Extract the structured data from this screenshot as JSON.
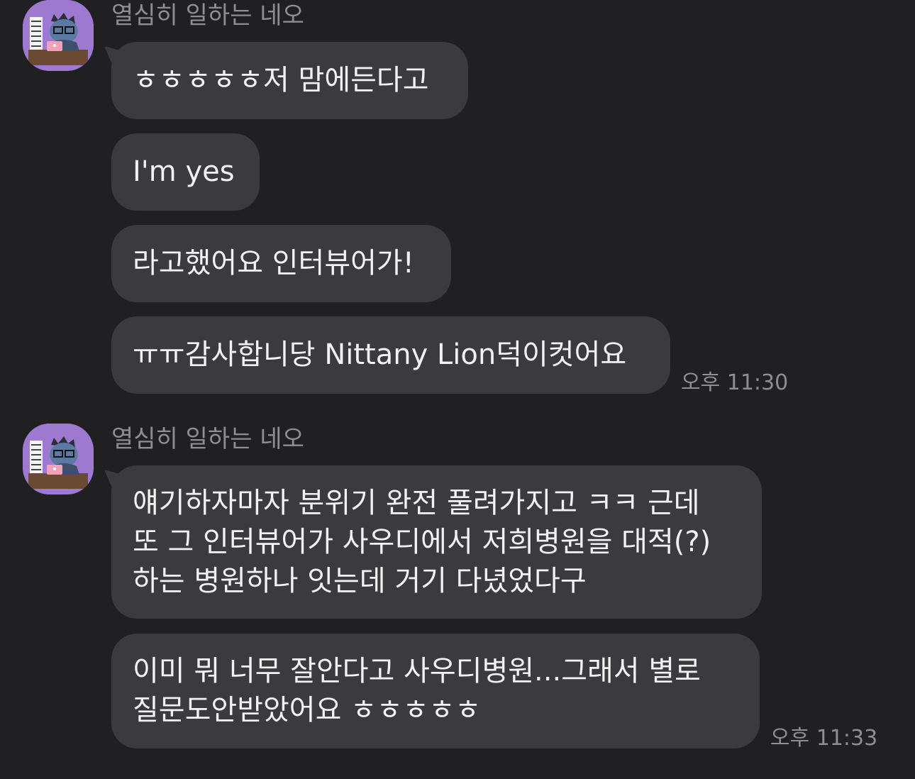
{
  "groups": [
    {
      "sender": "열심히 일하는 네오",
      "messages": [
        "ㅎㅎㅎㅎㅎ저 맘에든다고",
        "I'm yes",
        "라고했어요 인터뷰어가!",
        "ㅠㅠ감사합니당 Nittany Lion덕이컷어요"
      ],
      "time": "오후 11:30"
    },
    {
      "sender": "열심히 일하는 네오",
      "messages": [
        [
          "얘기하자마자 분위기 완전 풀려가지고 ㅋㅋ 근데",
          "또 그 인터뷰어가 사우디에서 저희병원을 대적(?)",
          "하는 병원하나 잇는데 거기 다녔었다구"
        ],
        [
          "이미 뭐 너무 잘안다고 사우디병원...그래서 별로",
          "질문도안받았어요 ㅎㅎㅎㅎㅎ"
        ]
      ],
      "time": "오후 11:33"
    }
  ],
  "colors": {
    "background": "#202023",
    "bubble": "#3b3b3f",
    "text": "#f2f2f2",
    "meta": "#8e8e92",
    "avatar": "#9d7ad0"
  },
  "icons": [
    "profile-avatar-neo"
  ]
}
